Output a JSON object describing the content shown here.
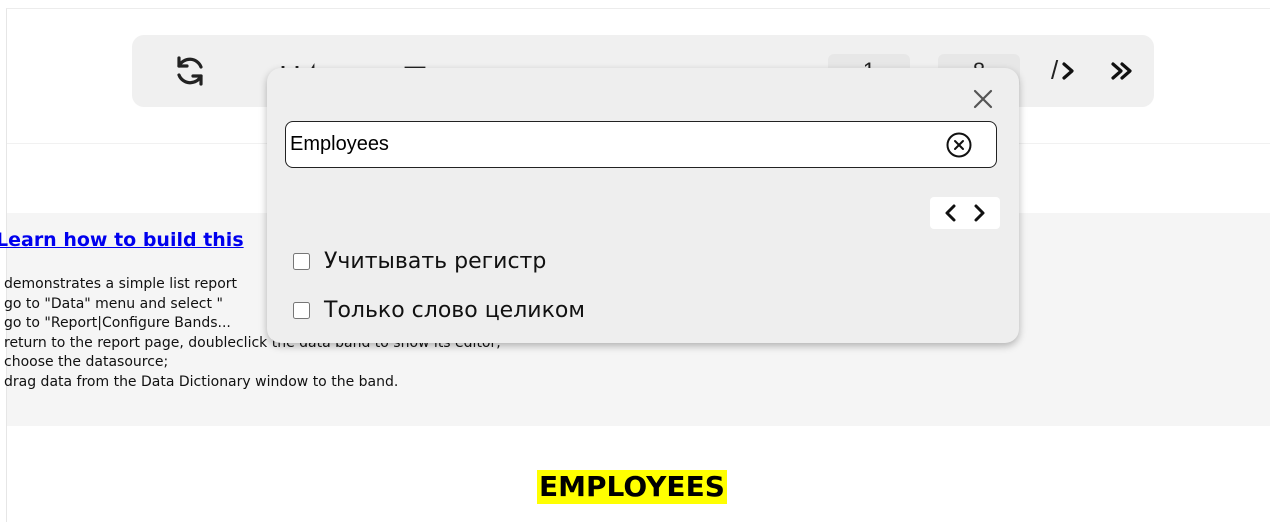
{
  "toolbar": {
    "current_page": "1",
    "total_pages": "8",
    "page_separator": "/",
    "icons": [
      "refresh-icon",
      "export-icon",
      "print-icon",
      "search-icon",
      "zoom-icon",
      "first-page-icon",
      "prev-page-icon",
      "next-page-icon",
      "last-page-icon"
    ]
  },
  "report": {
    "link_text": "Learn how to build this",
    "description": [
      "demonstrates a simple list report",
      "go to \"Data\" menu and select \"",
      "go to \"Report|Configure Bands...",
      "return to the report page, doubleclick the data band to show its editor;",
      "choose the datasource;",
      "drag data from the Data Dictionary window to the band."
    ],
    "title": "EMPLOYEES",
    "title_highlight": "#ffff00",
    "link_color": "#0000ee"
  },
  "search_popup": {
    "query": "Employees",
    "options": [
      {
        "label": "Учитывать регистр",
        "checked": false
      },
      {
        "label": "Только слово целиком",
        "checked": false
      }
    ],
    "icons": [
      "close-icon",
      "clear-icon",
      "prev-result-icon",
      "next-result-icon"
    ]
  }
}
